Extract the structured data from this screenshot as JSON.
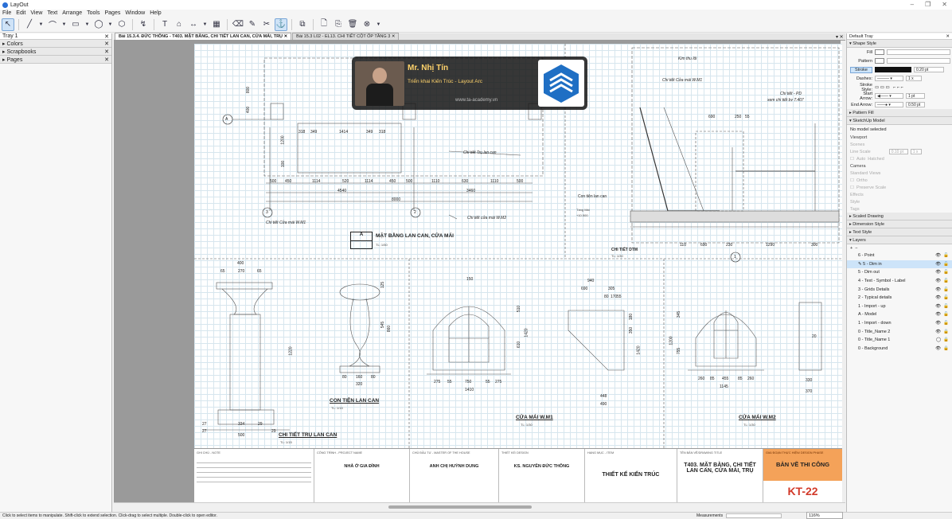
{
  "app": {
    "title": "LayOut"
  },
  "menu": [
    "File",
    "Edit",
    "View",
    "Text",
    "Arrange",
    "Tools",
    "Pages",
    "Window",
    "Help"
  ],
  "tabs": [
    {
      "label": "Bài 15.3.4. ĐỨC THÔNG - T403. MẶT BẰNG, CHI TIẾT LAN CAN, CỬA MÁI, TRỤ",
      "active": true
    },
    {
      "label": "Bài 15.3 L02 - EL13. CHI TIẾT CỘT ỐP TẦNG 3",
      "active": false
    }
  ],
  "left_tray": {
    "title": "Tray 1",
    "panels": [
      "Colors",
      "Scrapbooks",
      "Pages"
    ]
  },
  "right_tray": {
    "title": "Default Tray",
    "shape_style": {
      "header": "Shape Style",
      "fill": "Fill",
      "pattern": "Pattern",
      "stroke": "Stroke",
      "stroke_width": "0.20 pt",
      "dashes": "Dashes:",
      "dash_scale": "1 x",
      "stroke_style": "Stroke Style:",
      "start_arrow": "Start Arrow:",
      "start_arrow_val": "1 pt",
      "end_arrow": "End Arrow:",
      "end_arrow_val": "0.50 pt"
    },
    "pattern_fill": "Pattern Fill",
    "sketchup_model": {
      "header": "SketchUp Model",
      "status": "No model selected",
      "viewport": "Viewport",
      "scenes": "Scenes",
      "line_scale": "Line Scale",
      "line_scale_val": "0.10 pt",
      "line_scale_x": "1 x",
      "auto": "Auto",
      "hatched": "Hatched",
      "camera": "Camera",
      "standard_views": "Standard Views",
      "ortho": "Ortho",
      "preserve_scale": "Preserve Scale",
      "effects": "Effects",
      "style": "Style",
      "tags": "Tags"
    },
    "scaled_drawing": "Scaled Drawing",
    "dimension_style": "Dimension Style",
    "text_style": "Text Style",
    "layers": {
      "header": "Layers",
      "items": [
        {
          "name": "6 - Point",
          "selected": false
        },
        {
          "name": "5 - Dim in",
          "selected": true
        },
        {
          "name": "5 - Dim out",
          "selected": false
        },
        {
          "name": "4 - Text - Symbol - Label",
          "selected": false
        },
        {
          "name": "3 - Grids Details",
          "selected": false
        },
        {
          "name": "2 - Typical details",
          "selected": false
        },
        {
          "name": "1 - Import - up",
          "selected": false
        },
        {
          "name": "A - Model",
          "selected": false
        },
        {
          "name": "1 - Import - down",
          "selected": false
        },
        {
          "name": "0 - Title_Name 2",
          "selected": false
        },
        {
          "name": "0 - Title_Name 1",
          "selected": false
        },
        {
          "name": "0 - Background",
          "selected": false
        }
      ]
    }
  },
  "drawing": {
    "watermark": {
      "name": "Mr. Nhị Tín",
      "subtitle": "Triển khai Kiến Trúc - Layout Arc",
      "site": "www.ta-academy.vn"
    },
    "plan_title": "MẶT BẰNG LAN CAN, CỬA MÁI",
    "plan_scale": "TL: 1/50",
    "plan_mark": "A",
    "plan_dims_top": [
      "500",
      "450",
      "1114",
      "520",
      "1114",
      "450",
      "500",
      "1110",
      "630",
      "1110",
      "500"
    ],
    "plan_dims_mid": [
      "4540",
      "3460"
    ],
    "plan_dim_total": "8000",
    "plan_inner_dims": [
      "318",
      "349",
      "1414",
      "349",
      "318"
    ],
    "plan_left_dims": [
      "800",
      "400",
      "1200",
      "100"
    ],
    "grid_a": "A",
    "grid_3": "3",
    "grid_2": "2",
    "grid_1": "1",
    "label_cua_mai": "Chi tiết Cửa mái W.M1",
    "label_cua_mai2": "Chi tiết cửa mái W.M2",
    "label_tru": "Chi tiết Trụ lan can",
    "section_labels": {
      "kim_thu_loi": "Kim thu lôi",
      "cua_mai": "Chi tiết Cửa mái W.M1",
      "chi_tiet_pd": "Chi tiết - PD",
      "xem_chi_tiet": "xem chi tiết bv T.407",
      "con_tien": "Con tiện lan can",
      "tang_mai": "Tầng Mái",
      "tang_mai_lvl": "+10.500",
      "chi_tiet_dtm": "CHI TIẾT DTM",
      "dtm_scale": "TL: 1/30",
      "dims_bottom": [
        "110",
        "690",
        "230",
        "1290",
        "300"
      ],
      "dims_top": [
        "690",
        "250",
        "55"
      ]
    },
    "details": {
      "tru_title": "CHI TIẾT TRỤ LAN CAN",
      "tru_scale": "TL: 1/15",
      "tru_dims_top": [
        "400",
        "65",
        "270",
        "65"
      ],
      "tru_dims_bottom": [
        "27",
        "334",
        "29",
        "500",
        "27",
        "29"
      ],
      "tru_dim_h": "1220",
      "con_tien_title": "CON TIỆN LAN CAN",
      "con_tien_scale": "TL: 1/15",
      "con_tien_dims": [
        "80",
        "160",
        "80",
        "320",
        "125",
        "545",
        "860"
      ],
      "cua_mai1_title": "CỬA MÁI W.M1",
      "cua_mai1_scale": "TL: 1/30",
      "cua_mai1_dims": [
        "150",
        "275",
        "55",
        "750",
        "55",
        "275",
        "1410",
        "510",
        "610",
        "1420"
      ],
      "cua_mai1_side_dims": [
        "940",
        "690",
        "305",
        "80",
        "170",
        "55",
        "448",
        "490",
        "180",
        "350",
        "1420"
      ],
      "cua_mai2_title": "CỬA MÁI W.M2",
      "cua_mai2_scale": "TL: 1/30",
      "cua_mai2_dims": [
        "260",
        "85",
        "455",
        "85",
        "260",
        "1145",
        "345",
        "755",
        "1200"
      ],
      "cua_mai2_side_dims": [
        "330",
        "370",
        "20"
      ]
    },
    "titleblock": {
      "chu_dau_tu_note_h": "GHI CHÚ - NOTE",
      "project_h": "CÔNG TRÌNH - PROJECT NAME",
      "project": "NHÀ Ở GIA ĐÌNH",
      "owner_h": "CHỦ ĐẦU TƯ - MASTER OF THE HOUSE",
      "owner": "ANH CHỊ HUỲNH DUNG",
      "design_h": "THIẾT KẾ/ DESIGN",
      "design": "KS. NGUYỄN ĐỨC THÔNG",
      "item_h": "HẠNG MỤC - ITEM",
      "item": "THIẾT KẾ KIẾN TRÚC",
      "drawing_h": "TÊN BẢN VẼ/DRAWING TITLE",
      "drawing": "T403. MẶT BẰNG, CHI TIẾT LAN CAN, CỬA MÁI, TRỤ",
      "phase_h": "GIAI ĐOẠN THỰC HIỆN/ DESIGN PHASE",
      "phase": "BẢN VẼ THI CÔNG",
      "sheet": "KT-22"
    }
  },
  "status": {
    "hint": "Click to select items to manipulate. Shift-click to extend selection. Click-drag to select multiple. Double-click to open editor.",
    "measurements": "Measurements",
    "zoom": "116%"
  },
  "colors": {
    "accent_orange": "#f4a259",
    "sheet_red": "#d23a2a",
    "select_blue": "#cde4f9",
    "grid": "#d7e6ee"
  }
}
